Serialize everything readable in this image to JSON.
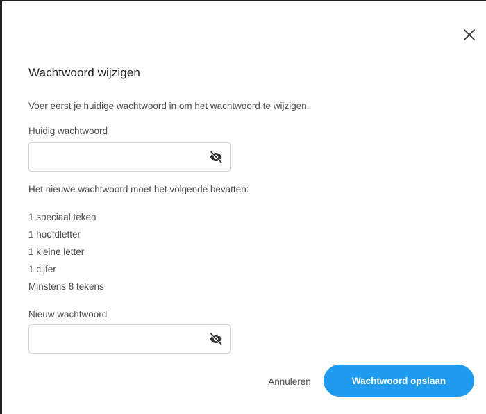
{
  "dialog": {
    "title": "Wachtwoord wijzigen",
    "intro": "Voer eerst je huidige wachtwoord in om het wachtwoord te wijzigen.",
    "current_password": {
      "label": "Huidig wachtwoord",
      "value": "",
      "placeholder": "",
      "toggle_icon": "eye-slash-icon"
    },
    "requirements_heading": "Het nieuwe wachtwoord moet het volgende bevatten:",
    "requirements": [
      "1 speciaal teken",
      "1 hoofdletter",
      "1 kleine letter",
      "1 cijfer",
      "Minstens 8 tekens"
    ],
    "new_password": {
      "label": "Nieuw wachtwoord",
      "value": "",
      "placeholder": "",
      "toggle_icon": "eye-slash-icon"
    },
    "cancel_label": "Annuleren",
    "save_label": "Wachtwoord opslaan",
    "close_icon": "close-icon"
  },
  "colors": {
    "primary": "#1e9bf0",
    "text": "#4a4a4a",
    "title": "#222222",
    "border": "#d3d6dc"
  }
}
